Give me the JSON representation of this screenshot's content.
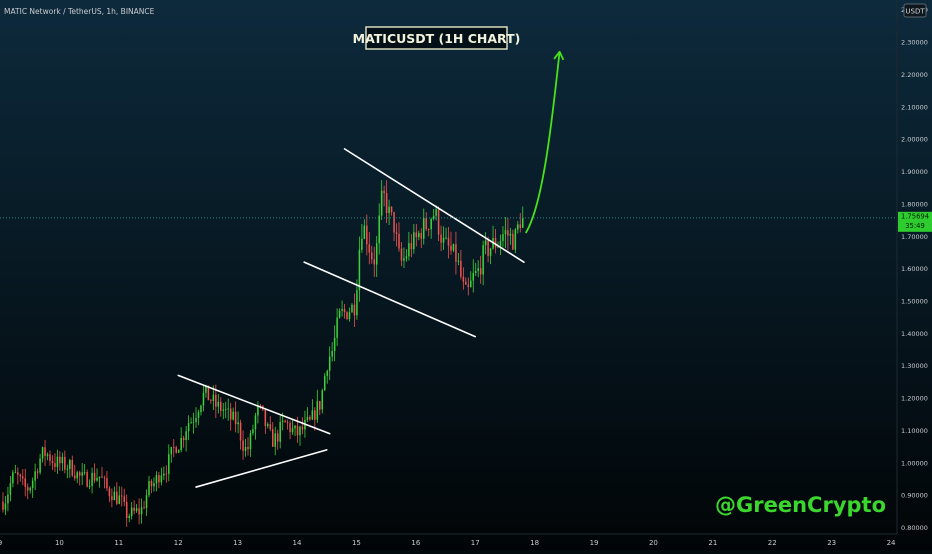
{
  "symbol_line": "MATIC Network / TetherUS, 1h, BINANCE",
  "currency": "USDT",
  "watermark": "@GreenCrypto",
  "colors": {
    "bg_top": "#0d2a3c",
    "bg_bottom": "#010507",
    "up": "#26a69a",
    "up_bright": "#3fd13a",
    "down": "#ef5350",
    "trendline": "#ffffff",
    "arrow": "#47e21a",
    "last_price": "#26a69a",
    "watermark": "#3bd62e",
    "axis_text": "#c9ccd1"
  },
  "chart_data": {
    "type": "candlestick",
    "title": "MATICUSDT (1H CHART)",
    "xlabel": "",
    "ylabel": "",
    "x_ticks": [
      "9",
      "10",
      "11",
      "12",
      "13",
      "14",
      "15",
      "16",
      "17",
      "18",
      "19",
      "20",
      "21",
      "22",
      "23",
      "24"
    ],
    "y_ticks": [
      "0.80000",
      "0.90000",
      "1.00000",
      "1.10000",
      "1.20000",
      "1.30000",
      "1.40000",
      "1.50000",
      "1.60000",
      "1.70000",
      "1.80000",
      "1.90000",
      "2.00000",
      "2.10000",
      "2.20000",
      "2.30000",
      "2.40000"
    ],
    "xlim": [
      9,
      24.1
    ],
    "ylim": [
      0.78,
      2.43
    ],
    "last_price": {
      "value": 1.75694,
      "label": "1.75694",
      "countdown": "35:49"
    },
    "price_keypoints": [
      [
        9.05,
        0.88
      ],
      [
        9.25,
        0.96
      ],
      [
        9.45,
        0.92
      ],
      [
        9.75,
        1.03
      ],
      [
        9.95,
        1.0
      ],
      [
        10.15,
        0.99
      ],
      [
        10.4,
        0.95
      ],
      [
        10.65,
        0.96
      ],
      [
        10.85,
        0.91
      ],
      [
        11.0,
        0.89
      ],
      [
        11.15,
        0.84
      ],
      [
        11.35,
        0.85
      ],
      [
        11.55,
        0.93
      ],
      [
        11.75,
        0.98
      ],
      [
        12.0,
        1.06
      ],
      [
        12.2,
        1.13
      ],
      [
        12.45,
        1.21
      ],
      [
        12.7,
        1.17
      ],
      [
        12.95,
        1.13
      ],
      [
        13.15,
        1.04
      ],
      [
        13.35,
        1.16
      ],
      [
        13.6,
        1.07
      ],
      [
        13.8,
        1.12
      ],
      [
        14.0,
        1.09
      ],
      [
        14.2,
        1.12
      ],
      [
        14.35,
        1.17
      ],
      [
        14.55,
        1.33
      ],
      [
        14.75,
        1.46
      ],
      [
        14.95,
        1.48
      ],
      [
        15.1,
        1.73
      ],
      [
        15.3,
        1.63
      ],
      [
        15.45,
        1.82
      ],
      [
        15.6,
        1.75
      ],
      [
        15.75,
        1.62
      ],
      [
        15.95,
        1.68
      ],
      [
        16.15,
        1.73
      ],
      [
        16.3,
        1.77
      ],
      [
        16.5,
        1.67
      ],
      [
        16.65,
        1.64
      ],
      [
        16.85,
        1.52
      ],
      [
        17.0,
        1.58
      ],
      [
        17.2,
        1.66
      ],
      [
        17.35,
        1.68
      ],
      [
        17.5,
        1.71
      ],
      [
        17.65,
        1.69
      ],
      [
        17.78,
        1.757
      ]
    ],
    "series_colors": {
      "up": "#26a69a",
      "down": "#ef5350"
    },
    "annotations": [
      {
        "type": "trendline",
        "from": [
          12.0,
          1.27
        ],
        "to": [
          14.55,
          1.09
        ]
      },
      {
        "type": "trendline",
        "from": [
          12.3,
          0.925
        ],
        "to": [
          14.5,
          1.04
        ]
      },
      {
        "type": "trendline",
        "from": [
          14.8,
          1.97
        ],
        "to": [
          17.82,
          1.62
        ]
      },
      {
        "type": "trendline",
        "from": [
          14.12,
          1.62
        ],
        "to": [
          17.0,
          1.39
        ]
      },
      {
        "type": "arrow",
        "path": [
          [
            17.85,
            1.71
          ],
          [
            18.15,
            1.8
          ],
          [
            18.3,
            2.07
          ],
          [
            18.42,
            2.27
          ]
        ]
      }
    ],
    "grid": false,
    "legend": "none"
  }
}
